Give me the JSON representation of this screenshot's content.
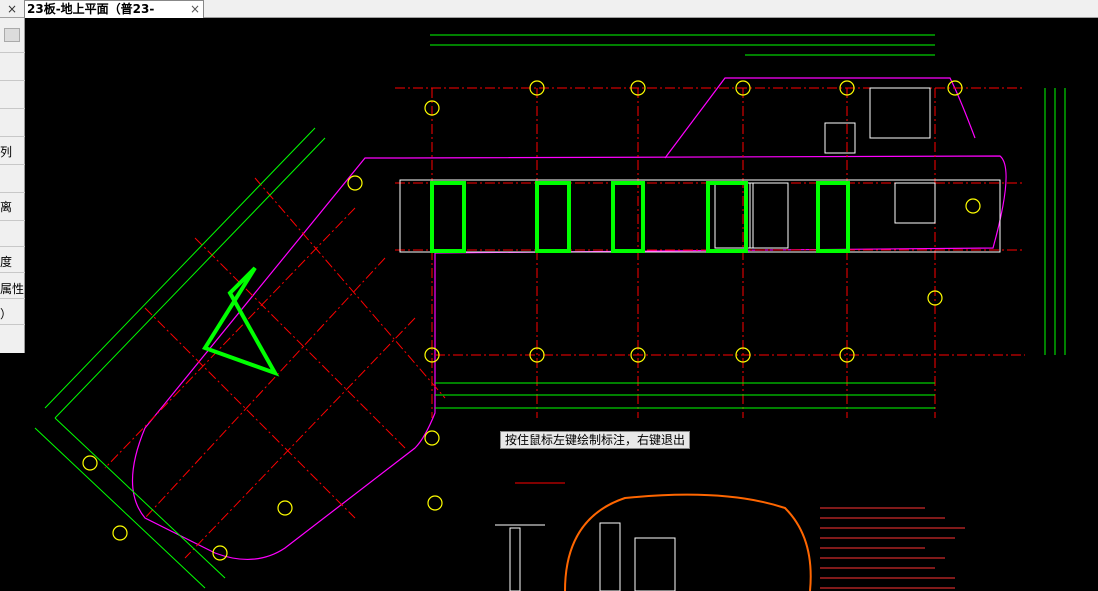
{
  "tabs": {
    "left_close": "×",
    "active_title": "23板-地上平面（普23-",
    "active_close": "×"
  },
  "side_panel": {
    "labels": [
      "列",
      "离",
      "度",
      "属性",
      "）"
    ]
  },
  "status": {
    "hint": "按住鼠标左键绘制标注，右键退出"
  },
  "colors": {
    "canvas": "#000000",
    "dimension": "#00ff00",
    "axis": "#ff0000",
    "axis_bubble": "#ffff00",
    "wall": "#ffffff",
    "column_highlight": "#00ff00",
    "outline": "#ff00ff",
    "cloud_markup": "#ff6600"
  }
}
